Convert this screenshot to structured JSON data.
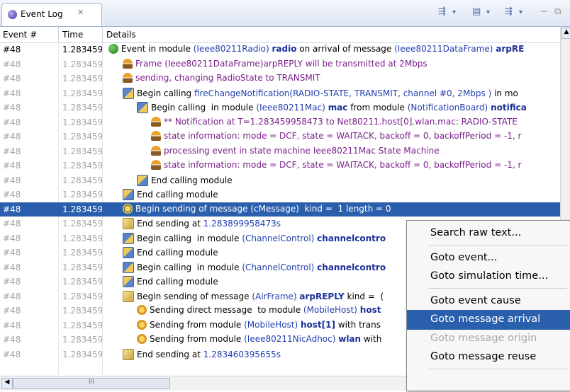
{
  "tab": {
    "title": "Event Log",
    "close": "✕"
  },
  "toolbar": {
    "icons": [
      "filter-icon",
      "dropdown",
      "screen-icon",
      "dropdown",
      "filter2-icon",
      "dropdown",
      "minimize",
      "maximize"
    ]
  },
  "columns": {
    "event": "Event #",
    "time": "Time",
    "details": "Details"
  },
  "rows": [
    {
      "event": "#48",
      "time": "1.283459",
      "dim": false,
      "sel": false,
      "indent": 0,
      "icon": "dot",
      "parts": [
        [
          "Event in module ",
          ""
        ],
        [
          "(Ieee80211Radio) ",
          "b"
        ],
        [
          "radio",
          "bb"
        ],
        [
          " on arrival of message ",
          ""
        ],
        [
          "(Ieee80211DataFrame) ",
          "b"
        ],
        [
          "arpRE",
          "bb"
        ]
      ]
    },
    {
      "event": "#48",
      "time": "1.283459",
      "dim": true,
      "sel": false,
      "indent": 1,
      "icon": "person",
      "parts": [
        [
          "Frame (Ieee80211DataFrame)arpREPLY will be transmitted at 2Mbps",
          "p"
        ]
      ]
    },
    {
      "event": "#48",
      "time": "1.283459",
      "dim": true,
      "sel": false,
      "indent": 1,
      "icon": "person",
      "parts": [
        [
          "sending, changing RadioState to TRANSMIT",
          "p"
        ]
      ]
    },
    {
      "event": "#48",
      "time": "1.283459",
      "dim": true,
      "sel": false,
      "indent": 1,
      "icon": "call",
      "parts": [
        [
          "Begin calling ",
          ""
        ],
        [
          "fireChangeNotification(RADIO-STATE, TRANSMIT, channel #0, 2Mbps )",
          "b"
        ],
        [
          " in mo",
          ""
        ]
      ]
    },
    {
      "event": "#48",
      "time": "1.283459",
      "dim": true,
      "sel": false,
      "indent": 2,
      "icon": "call",
      "parts": [
        [
          "Begin calling  in module ",
          ""
        ],
        [
          "(Ieee80211Mac) ",
          "b"
        ],
        [
          "mac",
          "bb"
        ],
        [
          " from module ",
          ""
        ],
        [
          "(NotificationBoard) ",
          "b"
        ],
        [
          "notifica",
          "bb"
        ]
      ]
    },
    {
      "event": "#48",
      "time": "1.283459",
      "dim": true,
      "sel": false,
      "indent": 3,
      "icon": "person",
      "parts": [
        [
          "** Notification at T=1.283459958473 to Net80211.host[0].wlan.mac: RADIO-STATE",
          "p"
        ]
      ]
    },
    {
      "event": "#48",
      "time": "1.283459",
      "dim": true,
      "sel": false,
      "indent": 3,
      "icon": "person",
      "parts": [
        [
          "state information: mode = DCF, state = WAITACK, backoff = 0, backoffPeriod = -1, r",
          "p"
        ]
      ]
    },
    {
      "event": "#48",
      "time": "1.283459",
      "dim": true,
      "sel": false,
      "indent": 3,
      "icon": "person",
      "parts": [
        [
          "processing event in state machine Ieee80211Mac State Machine",
          "p"
        ]
      ]
    },
    {
      "event": "#48",
      "time": "1.283459",
      "dim": true,
      "sel": false,
      "indent": 3,
      "icon": "person",
      "parts": [
        [
          "state information: mode = DCF, state = WAITACK, backoff = 0, backoffPeriod = -1, r",
          "p"
        ]
      ]
    },
    {
      "event": "#48",
      "time": "1.283459",
      "dim": true,
      "sel": false,
      "indent": 2,
      "icon": "end",
      "parts": [
        [
          "End calling module",
          ""
        ]
      ]
    },
    {
      "event": "#48",
      "time": "1.283459",
      "dim": true,
      "sel": false,
      "indent": 1,
      "icon": "end",
      "parts": [
        [
          "End calling module",
          ""
        ]
      ]
    },
    {
      "event": "#48",
      "time": "1.283459",
      "dim": false,
      "sel": true,
      "indent": 1,
      "icon": "clock",
      "parts": [
        [
          "Begin sending of message (cMessage)  kind =  1 length = 0",
          ""
        ]
      ]
    },
    {
      "event": "#48",
      "time": "1.283459",
      "dim": true,
      "sel": false,
      "indent": 1,
      "icon": "env",
      "parts": [
        [
          "End sending at ",
          ""
        ],
        [
          "1.283899958473s",
          "b"
        ]
      ]
    },
    {
      "event": "#48",
      "time": "1.283459",
      "dim": true,
      "sel": false,
      "indent": 1,
      "icon": "call",
      "parts": [
        [
          "Begin calling  in module ",
          ""
        ],
        [
          "(ChannelControl) ",
          "b"
        ],
        [
          "channelcontro",
          "bb"
        ]
      ]
    },
    {
      "event": "#48",
      "time": "1.283459",
      "dim": true,
      "sel": false,
      "indent": 1,
      "icon": "end",
      "parts": [
        [
          "End calling module",
          ""
        ]
      ]
    },
    {
      "event": "#48",
      "time": "1.283459",
      "dim": true,
      "sel": false,
      "indent": 1,
      "icon": "call",
      "parts": [
        [
          "Begin calling  in module ",
          ""
        ],
        [
          "(ChannelControl) ",
          "b"
        ],
        [
          "channelcontro",
          "bb"
        ]
      ]
    },
    {
      "event": "#48",
      "time": "1.283459",
      "dim": true,
      "sel": false,
      "indent": 1,
      "icon": "end",
      "parts": [
        [
          "End calling module",
          ""
        ]
      ]
    },
    {
      "event": "#48",
      "time": "1.283459",
      "dim": true,
      "sel": false,
      "indent": 1,
      "icon": "env",
      "parts": [
        [
          "Begin sending of message ",
          ""
        ],
        [
          "(AirFrame) ",
          "b"
        ],
        [
          "arpREPLY",
          "bb"
        ],
        [
          " kind =  (",
          ""
        ]
      ]
    },
    {
      "event": "#48",
      "time": "1.283459",
      "dim": true,
      "sel": false,
      "indent": 2,
      "icon": "send",
      "parts": [
        [
          "Sending direct message  to module ",
          ""
        ],
        [
          "(MobileHost) ",
          "b"
        ],
        [
          "host",
          "bb"
        ]
      ]
    },
    {
      "event": "#48",
      "time": "1.283459",
      "dim": true,
      "sel": false,
      "indent": 2,
      "icon": "send",
      "parts": [
        [
          "Sending from module ",
          ""
        ],
        [
          "(MobileHost) ",
          "b"
        ],
        [
          "host[1]",
          "bb"
        ],
        [
          " with trans",
          ""
        ]
      ]
    },
    {
      "event": "#48",
      "time": "1.283459",
      "dim": true,
      "sel": false,
      "indent": 2,
      "icon": "send",
      "parts": [
        [
          "Sending from module ",
          ""
        ],
        [
          "(Ieee80211NicAdhoc) ",
          "b"
        ],
        [
          "wlan",
          "bb"
        ],
        [
          " with",
          ""
        ]
      ]
    },
    {
      "event": "#48",
      "time": "1.283459",
      "dim": true,
      "sel": false,
      "indent": 1,
      "icon": "env",
      "parts": [
        [
          "End sending at ",
          ""
        ],
        [
          "1.283460395655s",
          "b"
        ]
      ]
    }
  ],
  "menu": [
    {
      "label": "Search raw text...",
      "state": "normal"
    },
    {
      "sep": true
    },
    {
      "label": "Goto event...",
      "state": "normal"
    },
    {
      "label": "Goto simulation time...",
      "state": "normal"
    },
    {
      "sep": true
    },
    {
      "label": "Goto event cause",
      "state": "normal"
    },
    {
      "label": "Goto message arrival",
      "state": "highlight"
    },
    {
      "label": "Goto message origin",
      "state": "disabled"
    },
    {
      "label": "Goto message reuse",
      "state": "normal"
    },
    {
      "sep": true
    },
    {
      "label": "",
      "state": "normal"
    }
  ],
  "scroll": {
    "thumb_label": "III"
  }
}
